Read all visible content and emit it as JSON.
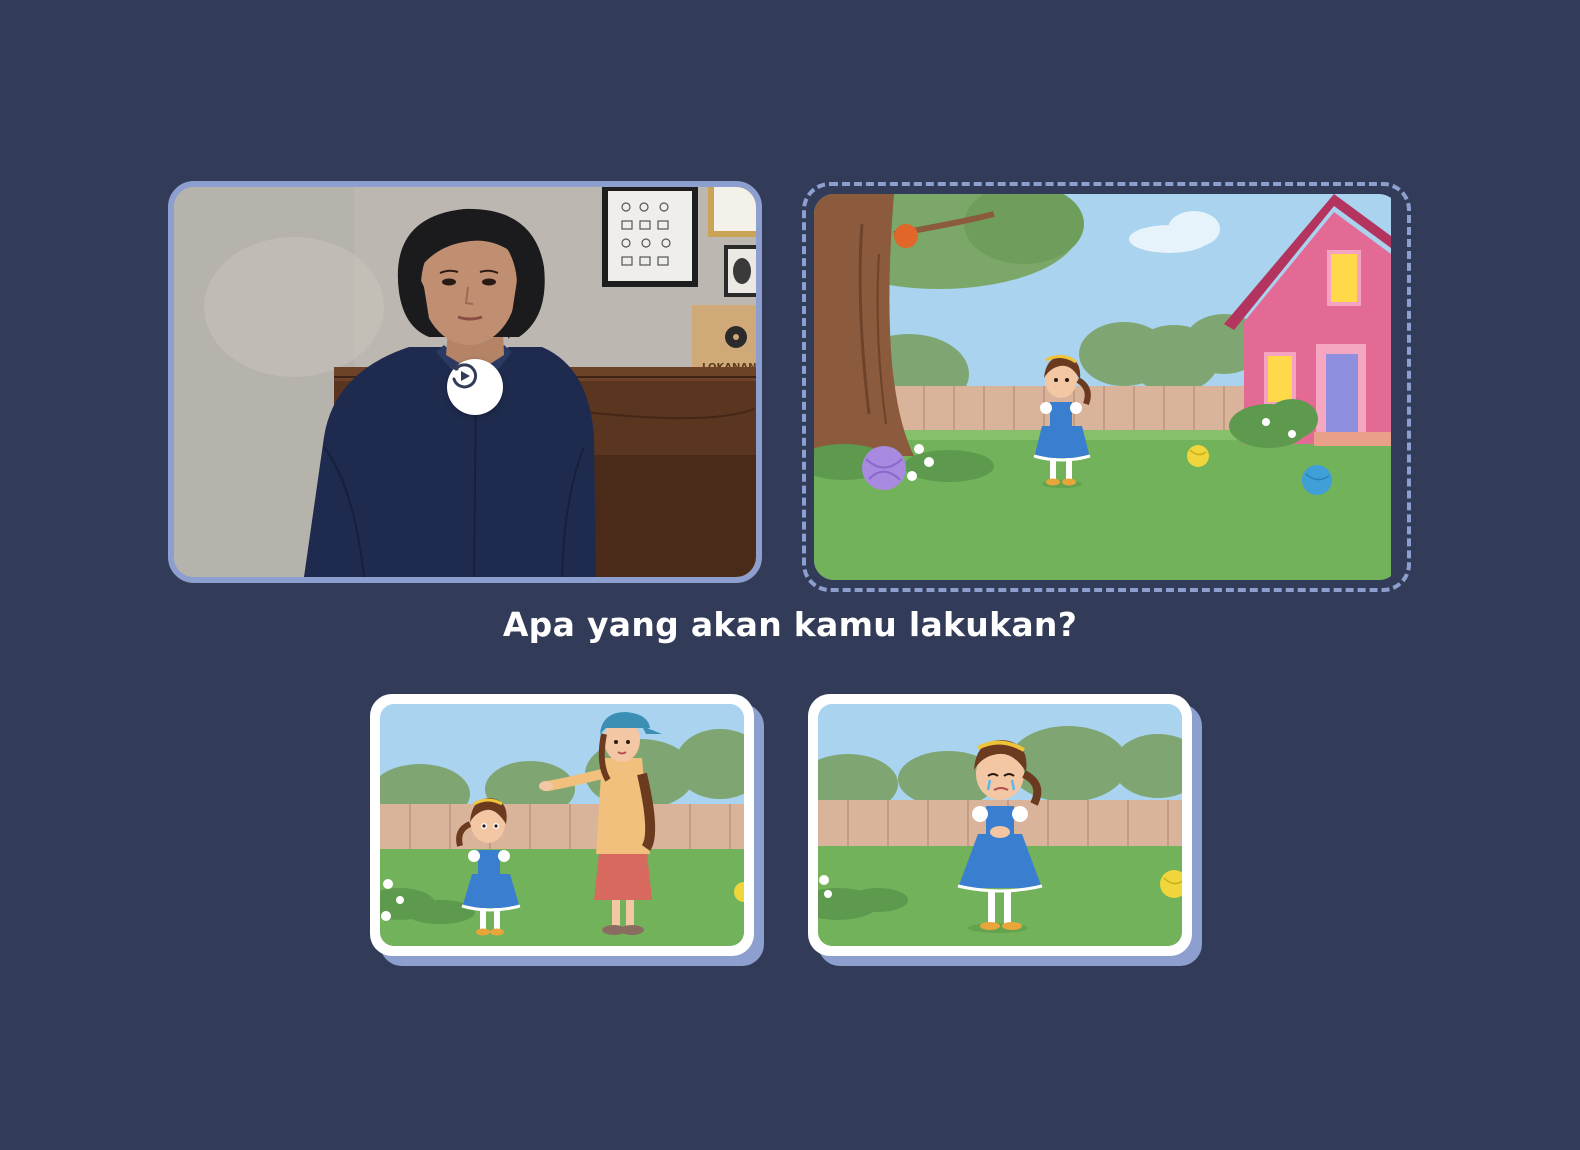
{
  "question": {
    "text": "Apa yang akan kamu lakukan?"
  },
  "video": {
    "replay_icon": "replay-icon",
    "sign_text": "LOKANANT"
  },
  "scene": {
    "type": "story-illustration"
  },
  "options": [
    {
      "id": "option-a",
      "icon": "illustration-mother-and-girl"
    },
    {
      "id": "option-b",
      "icon": "illustration-girl-crying"
    }
  ],
  "colors": {
    "background": "#323b57",
    "panel_border": "#8d9fce",
    "text": "#ffffff",
    "card": "#ffffff"
  }
}
